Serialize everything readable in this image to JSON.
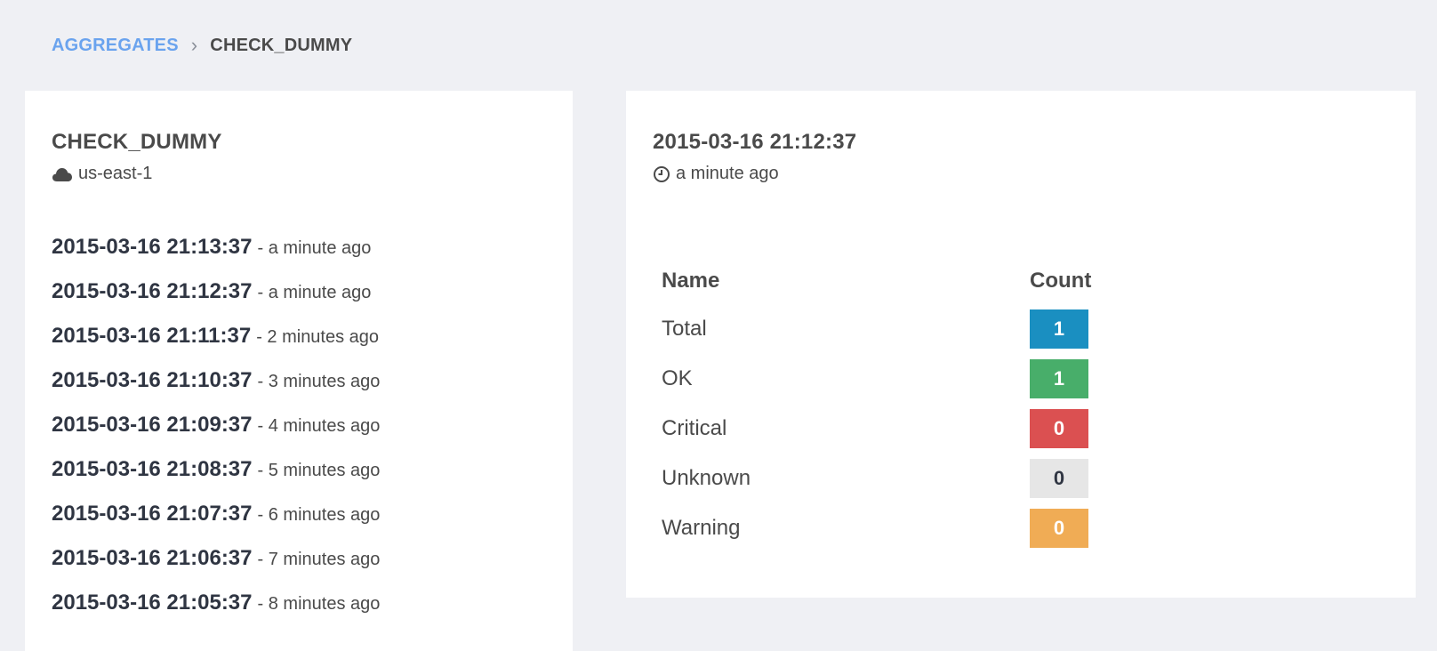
{
  "breadcrumb": {
    "parent": "AGGREGATES",
    "separator": "›",
    "current": "CHECK_DUMMY"
  },
  "check": {
    "title": "CHECK_DUMMY",
    "region_icon": "cloud-icon",
    "region": "us-east-1"
  },
  "history": [
    {
      "timestamp": "2015-03-16 21:13:37",
      "ago": "- a minute ago"
    },
    {
      "timestamp": "2015-03-16 21:12:37",
      "ago": "- a minute ago"
    },
    {
      "timestamp": "2015-03-16 21:11:37",
      "ago": "- 2 minutes ago"
    },
    {
      "timestamp": "2015-03-16 21:10:37",
      "ago": "- 3 minutes ago"
    },
    {
      "timestamp": "2015-03-16 21:09:37",
      "ago": "- 4 minutes ago"
    },
    {
      "timestamp": "2015-03-16 21:08:37",
      "ago": "- 5 minutes ago"
    },
    {
      "timestamp": "2015-03-16 21:07:37",
      "ago": "- 6 minutes ago"
    },
    {
      "timestamp": "2015-03-16 21:06:37",
      "ago": "- 7 minutes ago"
    },
    {
      "timestamp": "2015-03-16 21:05:37",
      "ago": "- 8 minutes ago"
    }
  ],
  "detail": {
    "timestamp": "2015-03-16 21:12:37",
    "time_icon": "clock-icon",
    "ago": "a minute ago",
    "table": {
      "headers": {
        "name": "Name",
        "count": "Count"
      },
      "rows": [
        {
          "name": "Total",
          "count": "1",
          "color": "#1a8fc1",
          "text_color": "#ffffff"
        },
        {
          "name": "OK",
          "count": "1",
          "color": "#48ae6a",
          "text_color": "#ffffff"
        },
        {
          "name": "Critical",
          "count": "0",
          "color": "#db5051",
          "text_color": "#ffffff"
        },
        {
          "name": "Unknown",
          "count": "0",
          "color": "#e6e6e6",
          "text_color": "#2f3542"
        },
        {
          "name": "Warning",
          "count": "0",
          "color": "#f0ac55",
          "text_color": "#ffffff"
        }
      ]
    }
  }
}
